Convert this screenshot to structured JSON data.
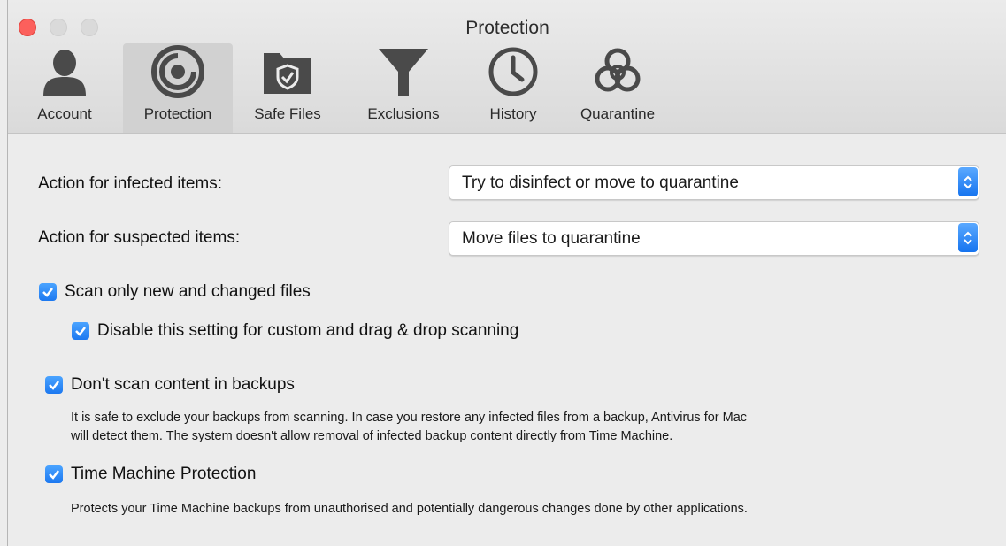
{
  "window": {
    "title": "Protection"
  },
  "tabs": [
    {
      "label": "Account",
      "icon": "user-icon"
    },
    {
      "label": "Protection",
      "icon": "protection-icon",
      "selected": true
    },
    {
      "label": "Safe Files",
      "icon": "safe-folder-icon"
    },
    {
      "label": "Exclusions",
      "icon": "filter-icon"
    },
    {
      "label": "History",
      "icon": "clock-icon"
    },
    {
      "label": "Quarantine",
      "icon": "biohazard-icon"
    }
  ],
  "settings": {
    "infected": {
      "label": "Action for infected items:",
      "value": "Try to disinfect or move to quarantine"
    },
    "suspected": {
      "label": "Action for suspected items:",
      "value": "Move files to quarantine"
    },
    "scan_new": {
      "label": "Scan only new and changed files",
      "checked": true
    },
    "disable_custom": {
      "label": "Disable this setting for custom and drag & drop scanning",
      "checked": true
    },
    "backups": {
      "label": "Don't scan content in backups",
      "checked": true,
      "description_line1": "It is safe to exclude your backups from scanning. In case you restore any infected files from a backup, Antivirus for Mac",
      "description_line2": "will detect them. The system doesn't allow removal of infected backup content directly from Time Machine."
    },
    "time_machine": {
      "label": "Time Machine Protection",
      "checked": true,
      "description": "Protects your Time Machine backups from unauthorised and potentially dangerous changes done by other applications."
    }
  },
  "colors": {
    "accent": "#1c78f0",
    "close": "#fc605c"
  }
}
